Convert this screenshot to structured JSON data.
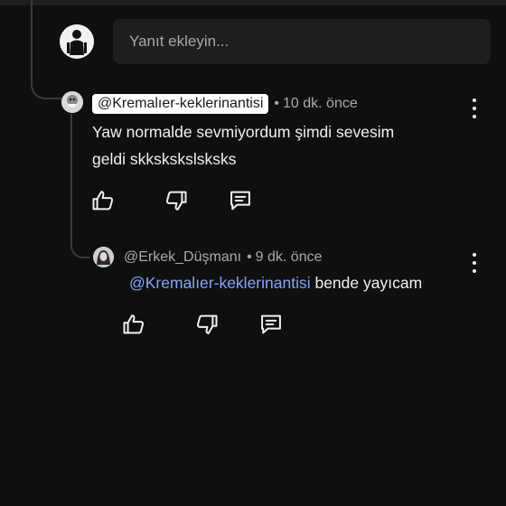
{
  "reply_input": {
    "placeholder": "Yanıt ekleyin..."
  },
  "comment": {
    "author": "@Kremalıer-keklerinantisi",
    "separator": "•",
    "time": "10 dk. önce",
    "text_line1": "Yaw normalde sevmiyordum şimdi sevesim",
    "text_line2": "geldi skkskskslsksks"
  },
  "reply": {
    "author": "@Erkek_Düşmanı",
    "separator": "•",
    "time": "9 dk. önce",
    "mention": "@Kremalıer-keklerinantisi",
    "text": " bende yayıcam"
  },
  "icons": {
    "like": "thumbs-up-icon",
    "dislike": "thumbs-down-icon",
    "reply": "comment-icon",
    "more": "more-vertical-icon"
  },
  "colors": {
    "background": "#0f0f0f",
    "mention": "#7fa6ff",
    "input_bg": "#1e1e1e"
  }
}
